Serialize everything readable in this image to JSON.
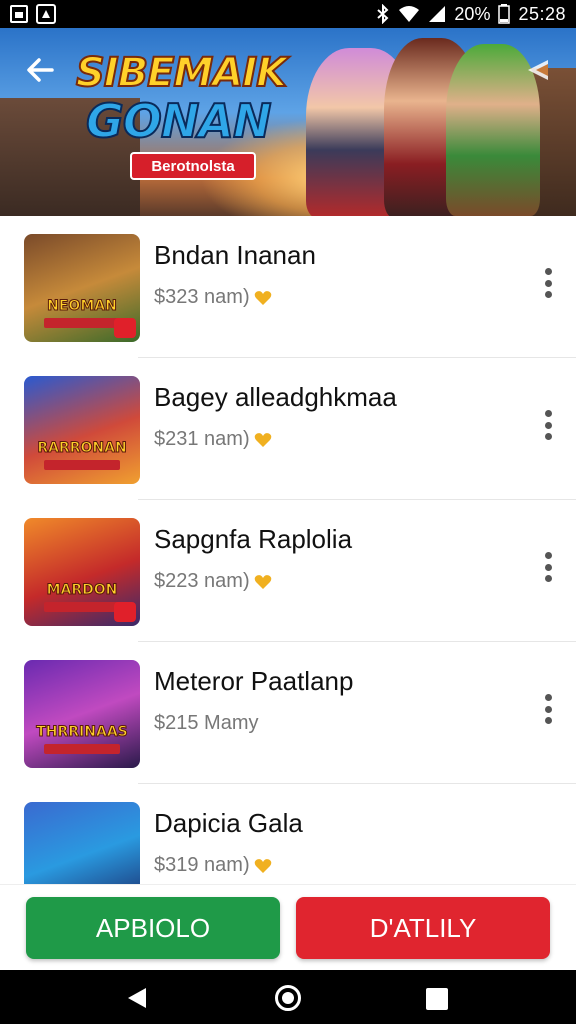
{
  "status_bar": {
    "left_icons": [
      "gallery-icon",
      "app-notification-icon"
    ],
    "right_icons": [
      "bluetooth-icon",
      "wifi-icon",
      "signal-icon"
    ],
    "battery": "20%",
    "time": "25:28"
  },
  "banner": {
    "logo_line1": "SIBEMAIK",
    "logo_line2": "GONAN",
    "logo_ribbon": "Berotnolsta"
  },
  "items": [
    {
      "title": "Bndan Inanan",
      "price": "$323 nam)",
      "favorite": true,
      "thumb_text": "NEOMAN",
      "thumb_colors": [
        "#7a4a2a",
        "#c68a3a",
        "#3a6a2a"
      ]
    },
    {
      "title": "Bagey alleadghkmaa",
      "price": "$231 nam)",
      "favorite": true,
      "thumb_text": "RARRONAN",
      "thumb_colors": [
        "#2a5ad0",
        "#d04a3a",
        "#f0a030"
      ]
    },
    {
      "title": "Sapgnfa Raplolia",
      "price": "$223 nam)",
      "favorite": true,
      "thumb_text": "MARDON",
      "thumb_colors": [
        "#f08a2a",
        "#c42a2a",
        "#3a2a6a"
      ]
    },
    {
      "title": "Meteror Paatlanp",
      "price": "$215 Mamy",
      "favorite": false,
      "thumb_text": "THRRINAAS",
      "thumb_colors": [
        "#6a2ab0",
        "#c04ac0",
        "#2a1a4a"
      ]
    },
    {
      "title": "Dapicia Gala",
      "price": "$319 nam)",
      "favorite": true,
      "thumb_text": "",
      "thumb_colors": [
        "#3a6ad0",
        "#2a9ae0",
        "#1a2a6a"
      ]
    }
  ],
  "actions": {
    "primary_label": "APBIOLO",
    "secondary_label": "D'ATLILY",
    "primary_color": "#1f9a48",
    "secondary_color": "#e0252f"
  },
  "nav": {
    "buttons": [
      "back-triangle-icon",
      "home-circle-icon",
      "recent-square-icon"
    ]
  }
}
